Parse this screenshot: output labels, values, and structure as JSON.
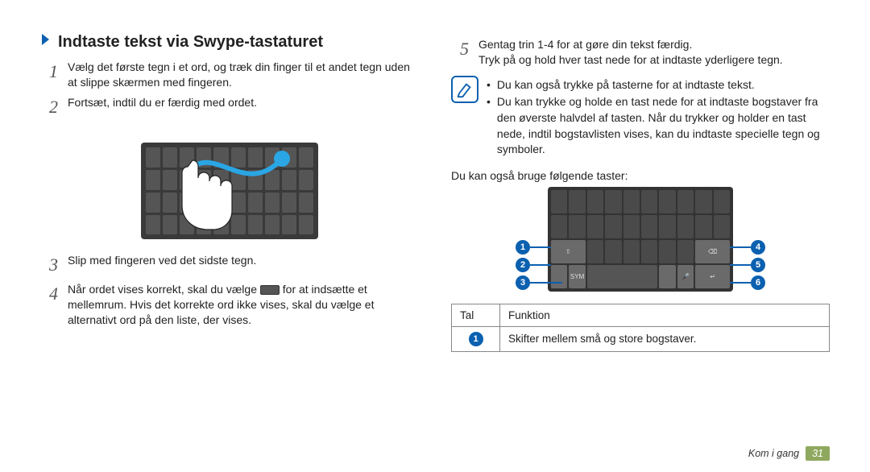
{
  "heading": "Indtaste tekst via Swype-tastaturet",
  "left": {
    "step1": "Vælg det første tegn i et ord, og træk din finger til et andet tegn uden at slippe skærmen med fingeren.",
    "step2": "Fortsæt, indtil du er færdig med ordet.",
    "step3": "Slip med fingeren ved det sidste tegn.",
    "step4_before": "Når ordet vises korrekt, skal du vælge",
    "step4_after": "for at indsætte et mellemrum. Hvis det korrekte ord ikke vises, skal du vælge et alternativt ord på den liste, der vises."
  },
  "right": {
    "step5_line1": "Gentag trin 1-4 for at gøre din tekst færdig.",
    "step5_line2": "Tryk på og hold hver tast nede for at indtaste yderligere tegn.",
    "tip1": "Du kan også trykke på tasterne for at indtaste tekst.",
    "tip2": "Du kan trykke og holde en tast nede for at indtaste bogstaver fra den øverste halvdel af tasten. Når du trykker og holder en tast nede, indtil bogstavlisten vises, kan du indtaste specielle tegn og symboler.",
    "also_use": "Du kan også bruge følgende taster:",
    "table": {
      "col_num": "Tal",
      "col_func": "Funktion",
      "row1_desc": "Skifter mellem små og store bogstaver."
    },
    "kbd_label_sym": "SYM",
    "callouts": [
      "1",
      "2",
      "3",
      "4",
      "5",
      "6"
    ]
  },
  "footer": {
    "section": "Kom i gang",
    "page": "31"
  }
}
